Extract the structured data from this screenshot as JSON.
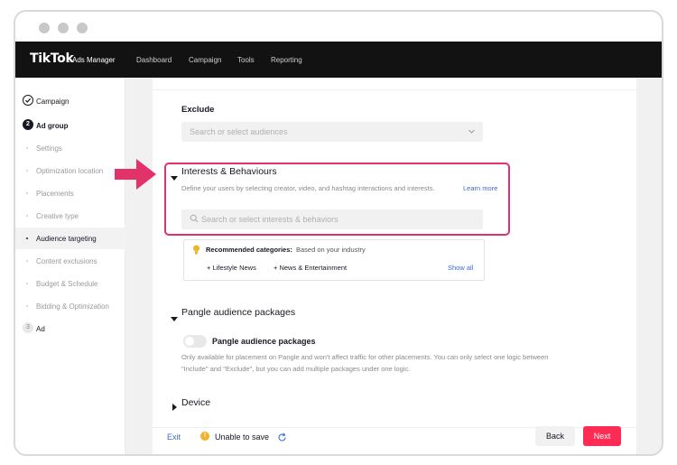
{
  "topbar": {
    "logo": "TikTok",
    "logo_sub": ": Ads Manager",
    "nav": [
      "Dashboard",
      "Campaign",
      "Tools",
      "Reporting"
    ]
  },
  "sidebar": {
    "steps": [
      {
        "label": "Campaign",
        "kind": "done"
      },
      {
        "label": "Ad group",
        "kind": "current",
        "number": "2"
      },
      {
        "label": "Settings",
        "kind": "sub"
      },
      {
        "label": "Optimization location",
        "kind": "sub"
      },
      {
        "label": "Placements",
        "kind": "sub"
      },
      {
        "label": "Creative type",
        "kind": "sub"
      },
      {
        "label": "Audience targeting",
        "kind": "sub-active"
      },
      {
        "label": "Content exclusions",
        "kind": "sub"
      },
      {
        "label": "Budget & Schedule",
        "kind": "sub"
      },
      {
        "label": "Bidding & Optimization",
        "kind": "sub"
      },
      {
        "label": "Ad",
        "kind": "pending",
        "number": "3"
      }
    ]
  },
  "exclude": {
    "label": "Exclude",
    "placeholder": "Search or select audiences"
  },
  "interests": {
    "title": "Interests & Behaviours",
    "description": "Define your users by selecting creator, video, and hashtag interactions and interests.",
    "learn_more": "Learn more",
    "placeholder": "Search or select interests & behaviors"
  },
  "recommended": {
    "heading": "Recommended categories:",
    "subheading": "Based on your industry",
    "chips": [
      "Lifestyle News",
      "News & Entertainment"
    ],
    "show_all": "Show all"
  },
  "pangle": {
    "title": "Pangle audience packages",
    "toggle_label": "Pangle audience packages",
    "toggle_on": false,
    "description_line1": "Only available for placement on Pangle and won't affect traffic for other placements. You can only select one logic between",
    "description_line2": "\"Include\" and \"Exclude\", but you can add multiple packages under one logic."
  },
  "device": {
    "title": "Device"
  },
  "footer": {
    "exit": "Exit",
    "status": "Unable to save",
    "back": "Back",
    "next": "Next"
  },
  "colors": {
    "accent": "#fe2c55",
    "highlight_border": "#e2326a",
    "arrow": "#e2326a",
    "link": "#3a68d8",
    "warning": "#f0b429",
    "topbar": "#121212"
  }
}
